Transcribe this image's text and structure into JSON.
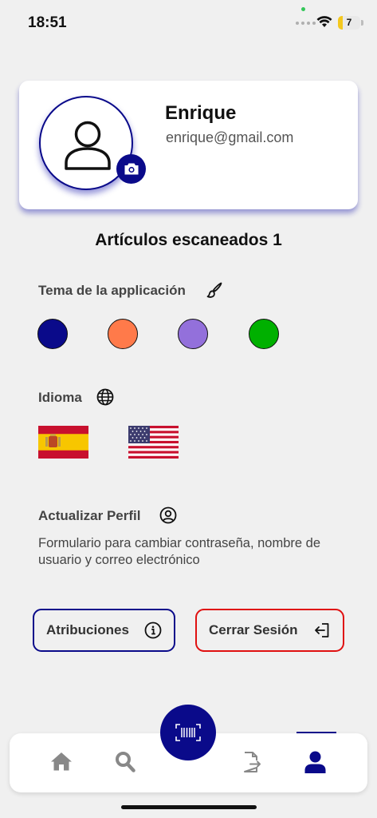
{
  "status_bar": {
    "time": "18:51",
    "battery_level": 7,
    "battery_percent": 0.07,
    "battery_label": "7"
  },
  "profile": {
    "name": "Enrique",
    "email": "enrique@gmail.com",
    "avatar_icon": "user-icon",
    "camera_icon": "camera-icon"
  },
  "scanned": {
    "label": "Artículos escaneados 1"
  },
  "theme": {
    "title": "Tema de la applicación",
    "icon": "paintbrush-icon",
    "colors": [
      {
        "name": "navy",
        "hex": "#0a0a8a"
      },
      {
        "name": "orange",
        "hex": "#ff7a4a"
      },
      {
        "name": "purple",
        "hex": "#9370db"
      },
      {
        "name": "green",
        "hex": "#00b000"
      }
    ]
  },
  "language": {
    "title": "Idioma",
    "icon": "globe-icon",
    "flags": [
      "spain-flag",
      "usa-flag"
    ]
  },
  "update_profile": {
    "title": "Actualizar Perfil",
    "icon": "user-circle-icon",
    "description": "Formulario para cambiar contraseña, nombre de usuario y correo electrónico"
  },
  "buttons": {
    "attributions": "Atribuciones",
    "attributions_icon": "info-icon",
    "logout": "Cerrar Sesión",
    "logout_icon": "logout-icon"
  },
  "bottom_nav": {
    "items": [
      "home-icon",
      "search-icon",
      "scan-icon",
      "file-export-icon",
      "user-icon"
    ],
    "active": "user-icon"
  },
  "colors": {
    "accent": "#0a0a8a",
    "danger": "#e01010",
    "inactive": "#888888"
  }
}
